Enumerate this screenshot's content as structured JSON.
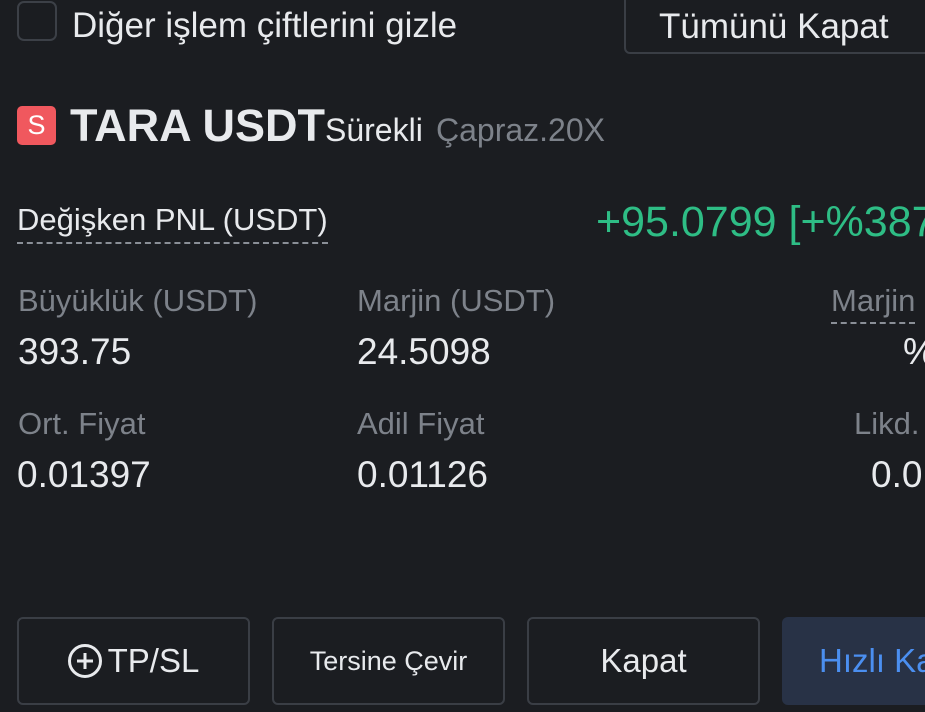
{
  "header": {
    "hide_other_pairs_label": "Diğer işlem çiftlerini gizle",
    "close_all_button": "Tümünü Kapat"
  },
  "position": {
    "side_badge": "S",
    "symbol": "TARA USDT",
    "contract_type": "Sürekli",
    "margin_mode": "Çapraz.20X",
    "unrealized_pnl_label": "Değişken PNL (USDT)",
    "unrealized_pnl_value": "+95.0799 [+%387",
    "size_label": "Büyüklük (USDT)",
    "size_value": "393.75",
    "margin_label": "Marjin (USDT)",
    "margin_value": "24.5098",
    "margin_ratio_label": "Marjin",
    "margin_ratio_value": "%",
    "entry_price_label": "Ort. Fiyat",
    "entry_price_value": "0.01397",
    "mark_price_label": "Adil Fiyat",
    "mark_price_value": "0.01126",
    "liq_price_label": "Likd.",
    "liq_price_value": "0.0"
  },
  "actions": {
    "tpsl": "TP/SL",
    "reverse": "Tersine Çevir",
    "close": "Kapat",
    "quick_close": "Hızlı Ka"
  },
  "colors": {
    "background": "#1b1d21",
    "profit": "#2ebd85",
    "short_badge": "#f0585e",
    "quick_close_text": "#4b8ff0"
  }
}
